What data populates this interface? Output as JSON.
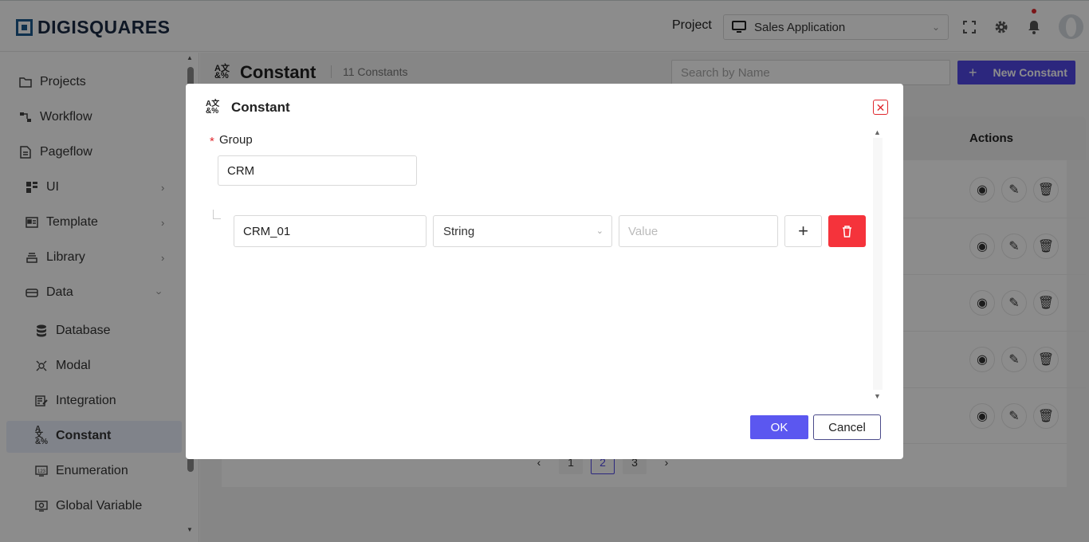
{
  "header": {
    "logo_text": "DIGISQUARES",
    "project_label": "Project",
    "project_value": "Sales Application"
  },
  "sidebar": {
    "items": [
      {
        "label": "Projects",
        "icon": "folder-icon"
      },
      {
        "label": "Workflow",
        "icon": "workflow-icon"
      },
      {
        "label": "Pageflow",
        "icon": "pageflow-icon"
      },
      {
        "label": "UI",
        "icon": "ui-icon"
      },
      {
        "label": "Template",
        "icon": "template-icon"
      },
      {
        "label": "Library",
        "icon": "library-icon"
      },
      {
        "label": "Data",
        "icon": "data-icon"
      },
      {
        "label": "Database",
        "icon": "database-icon"
      },
      {
        "label": "Modal",
        "icon": "modal-icon"
      },
      {
        "label": "Integration",
        "icon": "integration-icon"
      },
      {
        "label": "Constant",
        "icon": "constant-icon"
      },
      {
        "label": "Enumeration",
        "icon": "enumeration-icon"
      },
      {
        "label": "Global Variable",
        "icon": "global-variable-icon"
      }
    ],
    "active": "Constant"
  },
  "main": {
    "title": "Constant",
    "count": "11 Constants",
    "search_placeholder": "Search by Name",
    "new_button": "New Constant",
    "actions_header": "Actions",
    "pages": [
      "1",
      "2",
      "3"
    ],
    "current_page": "2"
  },
  "modal": {
    "title": "Constant",
    "group_label": "Group",
    "group_value": "CRM",
    "row": {
      "name": "CRM_01",
      "type": "String",
      "value_placeholder": "Value"
    },
    "ok_label": "OK",
    "cancel_label": "Cancel"
  },
  "colors": {
    "accent": "#5b57f0",
    "danger": "#f5333b",
    "brand": "#1d5a8e"
  }
}
